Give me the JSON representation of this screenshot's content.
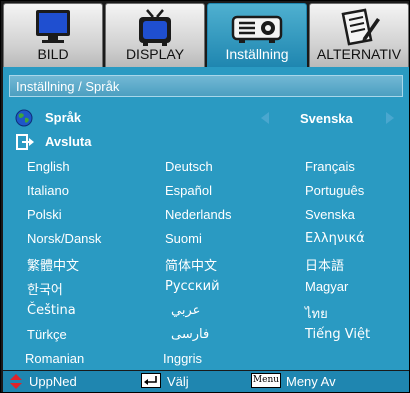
{
  "tabs": [
    {
      "label": "BILD",
      "icon": "monitor-icon",
      "active": false
    },
    {
      "label": "DISPLAY",
      "icon": "tv-icon",
      "active": false
    },
    {
      "label": "Inställning",
      "icon": "projector-icon",
      "active": true
    },
    {
      "label": "ALTERNATIV",
      "icon": "notepad-pencil-icon",
      "active": false
    }
  ],
  "breadcrumb": "Inställning / Språk",
  "language_row": {
    "label": "Språk",
    "value": "Svenska",
    "icon": "globe-icon"
  },
  "exit_row": {
    "label": "Avsluta",
    "icon": "exit-icon"
  },
  "languages": [
    [
      "English",
      "Deutsch",
      "Français"
    ],
    [
      "Italiano",
      "Español",
      "Português"
    ],
    [
      "Polski",
      "Nederlands",
      "Svenska"
    ],
    [
      "Norsk/Dansk",
      "Suomi",
      "Ελληνικά"
    ],
    [
      "繁體中文",
      "简体中文",
      "日本語"
    ],
    [
      "한국어",
      "Русский",
      "Magyar"
    ],
    [
      "Čeština",
      "عربي",
      "ไทย"
    ],
    [
      "Türkçe",
      "فارسی",
      "Tiếng Việt"
    ],
    [
      "Romanian",
      "Inggris",
      ""
    ]
  ],
  "footer": {
    "updown_label": "UppNed",
    "select_label": "Välj",
    "menu_key": "Menu",
    "menu_label": "Meny Av"
  },
  "colors": {
    "accent": "#2a9ac2",
    "active_tab": "#1f86b0",
    "icon_arrow": "#e0242a"
  }
}
